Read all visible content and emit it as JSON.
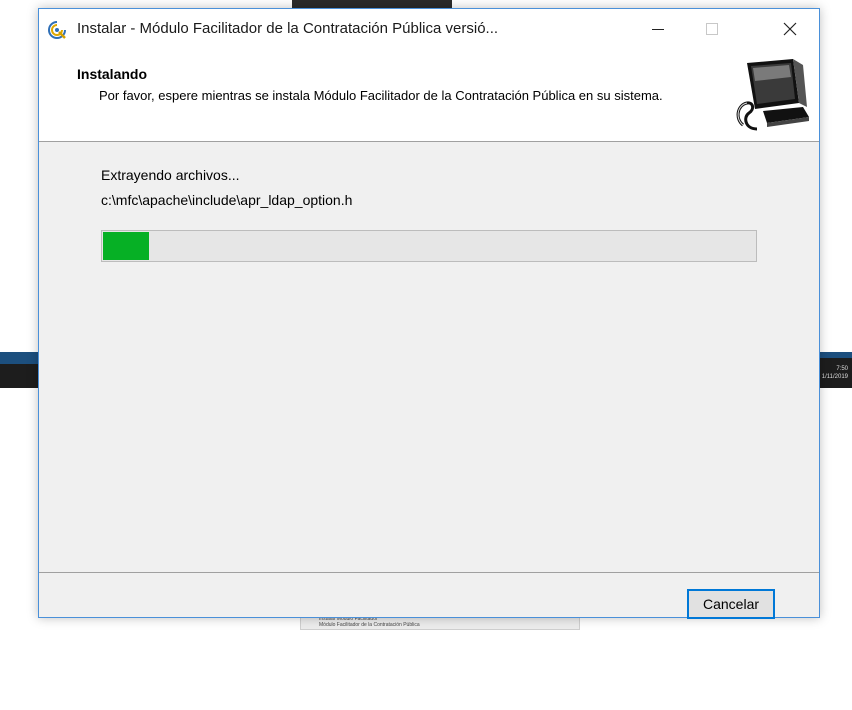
{
  "window": {
    "title": "Instalar - Módulo Facilitador de la Contratación Pública versió...",
    "minimize_glyph": "—",
    "close_glyph": "✕",
    "icon": "setup-app-icon"
  },
  "header": {
    "title": "Instalando",
    "description": "Por favor, espere mientras se instala Módulo Facilitador de la Contratación Pública en su sistema.",
    "image_icon": "computer-installer-icon"
  },
  "body": {
    "status_label": "Extrayendo archivos...",
    "current_file": "c:\\mfc\\apache\\include\\apr_ldap_option.h",
    "progress_fraction": 0.07
  },
  "footer": {
    "cancel_label": "Cancelar"
  },
  "background": {
    "bottom_doc_line1": "Instalar Módulo Facilitador",
    "bottom_doc_line2": "Módulo Facilitador de la Contratación Pública",
    "right_time": "7:50",
    "right_date": "1/11/2019"
  },
  "colors": {
    "progress_fill": "#06b025",
    "accent": "#0078d7"
  }
}
